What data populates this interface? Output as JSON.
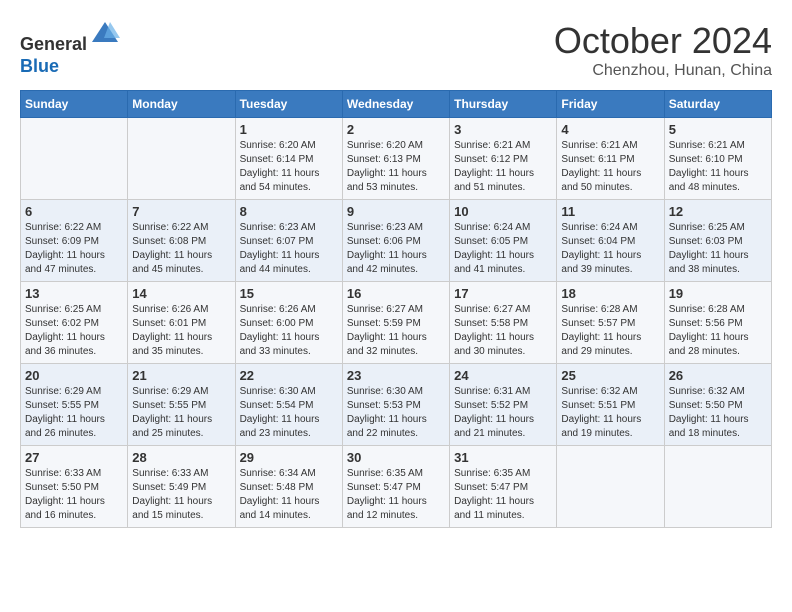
{
  "header": {
    "logo_line1": "General",
    "logo_line2": "Blue",
    "month": "October 2024",
    "location": "Chenzhou, Hunan, China"
  },
  "weekdays": [
    "Sunday",
    "Monday",
    "Tuesday",
    "Wednesday",
    "Thursday",
    "Friday",
    "Saturday"
  ],
  "weeks": [
    [
      {
        "day": "",
        "info": ""
      },
      {
        "day": "",
        "info": ""
      },
      {
        "day": "1",
        "info": "Sunrise: 6:20 AM\nSunset: 6:14 PM\nDaylight: 11 hours and 54 minutes."
      },
      {
        "day": "2",
        "info": "Sunrise: 6:20 AM\nSunset: 6:13 PM\nDaylight: 11 hours and 53 minutes."
      },
      {
        "day": "3",
        "info": "Sunrise: 6:21 AM\nSunset: 6:12 PM\nDaylight: 11 hours and 51 minutes."
      },
      {
        "day": "4",
        "info": "Sunrise: 6:21 AM\nSunset: 6:11 PM\nDaylight: 11 hours and 50 minutes."
      },
      {
        "day": "5",
        "info": "Sunrise: 6:21 AM\nSunset: 6:10 PM\nDaylight: 11 hours and 48 minutes."
      }
    ],
    [
      {
        "day": "6",
        "info": "Sunrise: 6:22 AM\nSunset: 6:09 PM\nDaylight: 11 hours and 47 minutes."
      },
      {
        "day": "7",
        "info": "Sunrise: 6:22 AM\nSunset: 6:08 PM\nDaylight: 11 hours and 45 minutes."
      },
      {
        "day": "8",
        "info": "Sunrise: 6:23 AM\nSunset: 6:07 PM\nDaylight: 11 hours and 44 minutes."
      },
      {
        "day": "9",
        "info": "Sunrise: 6:23 AM\nSunset: 6:06 PM\nDaylight: 11 hours and 42 minutes."
      },
      {
        "day": "10",
        "info": "Sunrise: 6:24 AM\nSunset: 6:05 PM\nDaylight: 11 hours and 41 minutes."
      },
      {
        "day": "11",
        "info": "Sunrise: 6:24 AM\nSunset: 6:04 PM\nDaylight: 11 hours and 39 minutes."
      },
      {
        "day": "12",
        "info": "Sunrise: 6:25 AM\nSunset: 6:03 PM\nDaylight: 11 hours and 38 minutes."
      }
    ],
    [
      {
        "day": "13",
        "info": "Sunrise: 6:25 AM\nSunset: 6:02 PM\nDaylight: 11 hours and 36 minutes."
      },
      {
        "day": "14",
        "info": "Sunrise: 6:26 AM\nSunset: 6:01 PM\nDaylight: 11 hours and 35 minutes."
      },
      {
        "day": "15",
        "info": "Sunrise: 6:26 AM\nSunset: 6:00 PM\nDaylight: 11 hours and 33 minutes."
      },
      {
        "day": "16",
        "info": "Sunrise: 6:27 AM\nSunset: 5:59 PM\nDaylight: 11 hours and 32 minutes."
      },
      {
        "day": "17",
        "info": "Sunrise: 6:27 AM\nSunset: 5:58 PM\nDaylight: 11 hours and 30 minutes."
      },
      {
        "day": "18",
        "info": "Sunrise: 6:28 AM\nSunset: 5:57 PM\nDaylight: 11 hours and 29 minutes."
      },
      {
        "day": "19",
        "info": "Sunrise: 6:28 AM\nSunset: 5:56 PM\nDaylight: 11 hours and 28 minutes."
      }
    ],
    [
      {
        "day": "20",
        "info": "Sunrise: 6:29 AM\nSunset: 5:55 PM\nDaylight: 11 hours and 26 minutes."
      },
      {
        "day": "21",
        "info": "Sunrise: 6:29 AM\nSunset: 5:55 PM\nDaylight: 11 hours and 25 minutes."
      },
      {
        "day": "22",
        "info": "Sunrise: 6:30 AM\nSunset: 5:54 PM\nDaylight: 11 hours and 23 minutes."
      },
      {
        "day": "23",
        "info": "Sunrise: 6:30 AM\nSunset: 5:53 PM\nDaylight: 11 hours and 22 minutes."
      },
      {
        "day": "24",
        "info": "Sunrise: 6:31 AM\nSunset: 5:52 PM\nDaylight: 11 hours and 21 minutes."
      },
      {
        "day": "25",
        "info": "Sunrise: 6:32 AM\nSunset: 5:51 PM\nDaylight: 11 hours and 19 minutes."
      },
      {
        "day": "26",
        "info": "Sunrise: 6:32 AM\nSunset: 5:50 PM\nDaylight: 11 hours and 18 minutes."
      }
    ],
    [
      {
        "day": "27",
        "info": "Sunrise: 6:33 AM\nSunset: 5:50 PM\nDaylight: 11 hours and 16 minutes."
      },
      {
        "day": "28",
        "info": "Sunrise: 6:33 AM\nSunset: 5:49 PM\nDaylight: 11 hours and 15 minutes."
      },
      {
        "day": "29",
        "info": "Sunrise: 6:34 AM\nSunset: 5:48 PM\nDaylight: 11 hours and 14 minutes."
      },
      {
        "day": "30",
        "info": "Sunrise: 6:35 AM\nSunset: 5:47 PM\nDaylight: 11 hours and 12 minutes."
      },
      {
        "day": "31",
        "info": "Sunrise: 6:35 AM\nSunset: 5:47 PM\nDaylight: 11 hours and 11 minutes."
      },
      {
        "day": "",
        "info": ""
      },
      {
        "day": "",
        "info": ""
      }
    ]
  ]
}
